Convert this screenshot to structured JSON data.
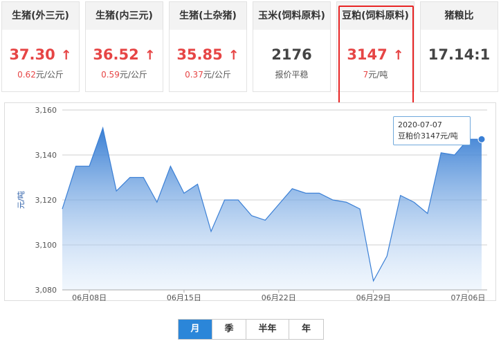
{
  "cards": [
    {
      "title": "生猪(外三元)",
      "value": "37.30",
      "arrow": "↑",
      "sub_num": "0.62",
      "sub_unit": "元/公斤"
    },
    {
      "title": "生猪(内三元)",
      "value": "36.52",
      "arrow": "↑",
      "sub_num": "0.59",
      "sub_unit": "元/公斤"
    },
    {
      "title": "生猪(土杂猪)",
      "value": "35.85",
      "arrow": "↑",
      "sub_num": "0.37",
      "sub_unit": "元/公斤"
    },
    {
      "title": "玉米(饲料原料)",
      "value": "2176",
      "arrow": "",
      "sub_num": "",
      "sub_unit": "报价平稳"
    },
    {
      "title": "豆粕(饲料原料)",
      "value": "3147",
      "arrow": "↑",
      "sub_num": "7",
      "sub_unit": "元/吨"
    },
    {
      "title": "猪粮比",
      "value": "17.14:1",
      "arrow": "",
      "sub_num": "",
      "sub_unit": ""
    }
  ],
  "colors": {
    "up": "#e64545",
    "line": "#3a7fd5",
    "active_tab": "#2b86d9"
  },
  "tooltip": {
    "date": "2020-07-07",
    "label": "豆粕价3147元/吨"
  },
  "tabs": [
    {
      "label": "月",
      "active": true
    },
    {
      "label": "季",
      "active": false
    },
    {
      "label": "半年",
      "active": false
    },
    {
      "label": "年",
      "active": false
    }
  ],
  "chart_data": {
    "type": "area",
    "ylabel": "元/吨",
    "ylim": [
      3080,
      3160
    ],
    "yticks": [
      3080,
      3100,
      3120,
      3140,
      3160
    ],
    "ytick_labels": [
      "3,080",
      "3,100",
      "3,120",
      "3,140",
      "3,160"
    ],
    "xtick_labels": [
      {
        "label": "06月08日",
        "index": 2
      },
      {
        "label": "06月15日",
        "index": 9
      },
      {
        "label": "06月22日",
        "index": 16
      },
      {
        "label": "06月29日",
        "index": 23
      },
      {
        "label": "07月06日",
        "index": 30
      }
    ],
    "x": [
      "06-06",
      "06-07",
      "06-08",
      "06-09",
      "06-10",
      "06-11",
      "06-12",
      "06-13",
      "06-14",
      "06-15",
      "06-16",
      "06-17",
      "06-18",
      "06-19",
      "06-20",
      "06-21",
      "06-22",
      "06-23",
      "06-24",
      "06-25",
      "06-26",
      "06-27",
      "06-28",
      "06-29",
      "06-30",
      "07-01",
      "07-02",
      "07-03",
      "07-04",
      "07-05",
      "07-06",
      "07-07"
    ],
    "values": [
      3116,
      3135,
      3135,
      3152,
      3124,
      3130,
      3130,
      3119,
      3135,
      3123,
      3127,
      3106,
      3120,
      3120,
      3113,
      3111,
      3118,
      3125,
      3123,
      3123,
      3120,
      3119,
      3116,
      3084,
      3095,
      3122,
      3119,
      3114,
      3141,
      3140,
      3147,
      3147
    ]
  }
}
